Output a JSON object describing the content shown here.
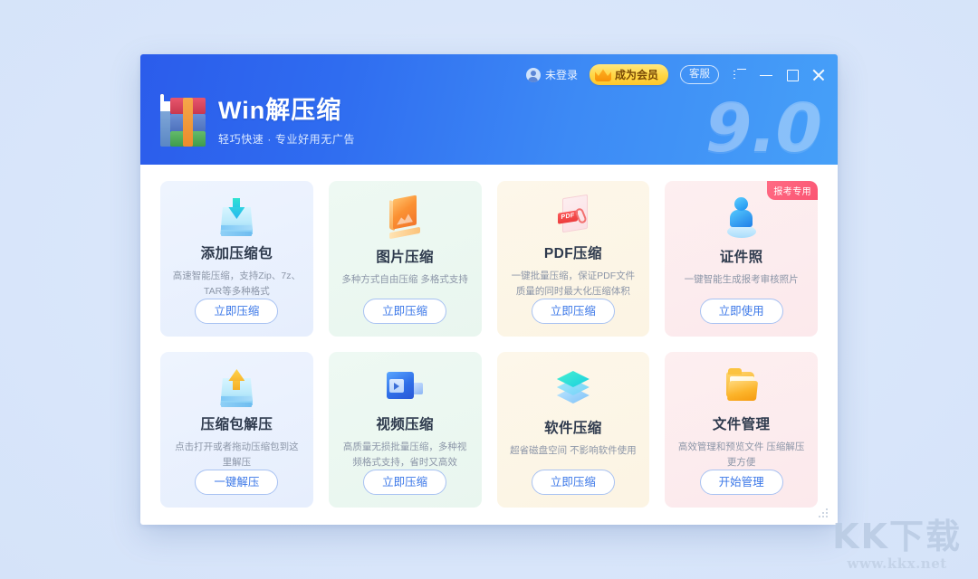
{
  "app": {
    "title": "Win解压缩",
    "subtitle": "轻巧快速 · 专业好用无广告",
    "version_watermark": "9.0",
    "logo_icon": "winrar-books-icon"
  },
  "header": {
    "user": {
      "icon": "user-avatar-icon",
      "label": "未登录"
    },
    "vip_button": {
      "icon": "crown-icon",
      "label": "成为会员"
    },
    "support_button": {
      "label": "客服"
    },
    "window_controls": [
      {
        "icon": "menu-list-icon",
        "name": "menu-button"
      },
      {
        "icon": "minimize-icon",
        "name": "minimize-button"
      },
      {
        "icon": "maximize-icon",
        "name": "maximize-button"
      },
      {
        "icon": "close-icon",
        "name": "close-button"
      }
    ],
    "colors": {
      "gradient_from": "#2b5ceb",
      "gradient_to": "#46a0f8"
    }
  },
  "cards": [
    {
      "id": "add-archive",
      "icon": "download-bin-icon",
      "title": "添加压缩包",
      "desc": "高速智能压缩，支持Zip、7z、TAR等多种格式",
      "button": "立即压缩",
      "theme": "bg-blue",
      "badge": null
    },
    {
      "id": "image-compress",
      "icon": "picture-frame-icon",
      "title": "图片压缩",
      "desc": "多种方式自由压缩 多格式支持",
      "button": "立即压缩",
      "theme": "bg-mint",
      "badge": null
    },
    {
      "id": "pdf-compress",
      "icon": "pdf-document-icon",
      "title": "PDF压缩",
      "desc": "一键批量压缩，保证PDF文件质量的同时最大化压缩体积",
      "button": "立即压缩",
      "theme": "bg-cream",
      "badge": null
    },
    {
      "id": "id-photo",
      "icon": "person-bust-icon",
      "title": "证件照",
      "desc": "一键智能生成报考审核照片",
      "button": "立即使用",
      "theme": "bg-pink",
      "badge": "报考专用"
    },
    {
      "id": "extract-archive",
      "icon": "upload-bin-icon",
      "title": "压缩包解压",
      "desc": "点击打开或者拖动压缩包到这里解压",
      "button": "一键解压",
      "theme": "bg-blue",
      "badge": null
    },
    {
      "id": "video-compress",
      "icon": "video-camera-icon",
      "title": "视频压缩",
      "desc": "高质量无损批量压缩，多种视频格式支持，省时又高效",
      "button": "立即压缩",
      "theme": "bg-mint",
      "badge": null
    },
    {
      "id": "software-compress",
      "icon": "layers-icon",
      "title": "软件压缩",
      "desc": "超省磁盘空间 不影响软件使用",
      "button": "立即压缩",
      "theme": "bg-cream",
      "badge": null
    },
    {
      "id": "file-manage",
      "icon": "folder-icon",
      "title": "文件管理",
      "desc": "高效管理和预览文件 压缩解压更方便",
      "button": "开始管理",
      "theme": "bg-pink",
      "badge": null
    }
  ],
  "pdf_tag_text": "PDF",
  "watermark": {
    "main": "KK下载",
    "sub": "www.kkx.net"
  }
}
